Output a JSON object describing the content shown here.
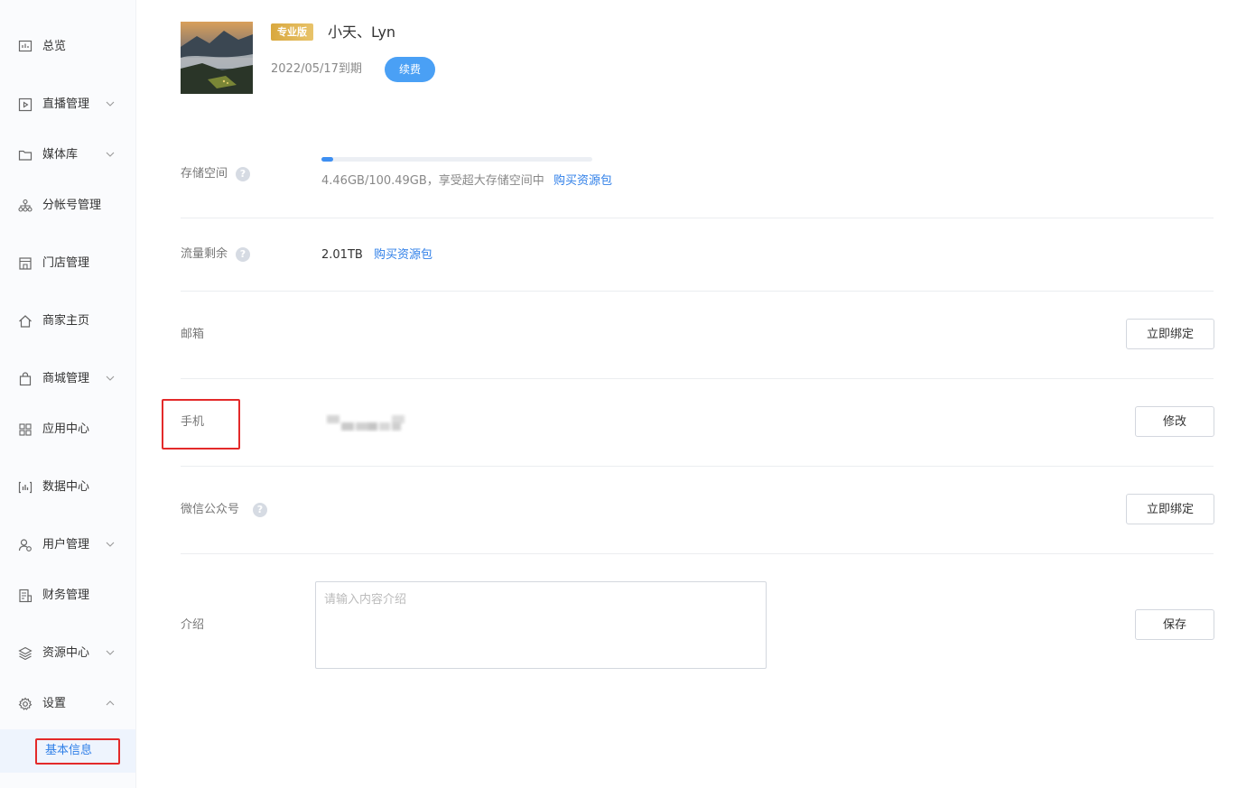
{
  "sidebar": {
    "items": [
      {
        "label": "总览",
        "icon": "overview-chart-icon"
      },
      {
        "label": "直播管理",
        "icon": "live-play-icon"
      },
      {
        "label": "媒体库",
        "icon": "folder-icon"
      },
      {
        "label": "分帐号管理",
        "icon": "org-tree-icon"
      },
      {
        "label": "门店管理",
        "icon": "store-icon"
      },
      {
        "label": "商家主页",
        "icon": "home-icon"
      },
      {
        "label": "商城管理",
        "icon": "shopping-bag-icon"
      },
      {
        "label": "应用中心",
        "icon": "app-grid-icon"
      },
      {
        "label": "数据中心",
        "icon": "data-icon"
      },
      {
        "label": "用户管理",
        "icon": "user-icon"
      },
      {
        "label": "财务管理",
        "icon": "finance-icon"
      },
      {
        "label": "资源中心",
        "icon": "layers-icon"
      },
      {
        "label": "设置",
        "icon": "gear-icon"
      }
    ],
    "active_sub_item": "基本信息"
  },
  "profile": {
    "badge": "专业版",
    "name": "小天、Lyn",
    "expire": "2022/05/17到期",
    "renew_label": "续费"
  },
  "storage": {
    "label": "存储空间",
    "used_fraction": 0.044,
    "text": "4.46GB/100.49GB，享受超大存储空间中",
    "buy_link": "购买资源包"
  },
  "traffic": {
    "label": "流量剩余",
    "value": "2.01TB",
    "buy_link": "购买资源包"
  },
  "email": {
    "label": "邮箱",
    "button": "立即绑定"
  },
  "phone": {
    "label": "手机",
    "button": "修改"
  },
  "wechat": {
    "label": "微信公众号",
    "button": "立即绑定"
  },
  "intro": {
    "label": "介绍",
    "placeholder": "请输入内容介绍",
    "button": "保存"
  },
  "colors": {
    "accent": "#2f7fe8",
    "renew": "#4aa0f5",
    "badge": "#d9a83e",
    "highlight_box": "#e32a2a"
  }
}
